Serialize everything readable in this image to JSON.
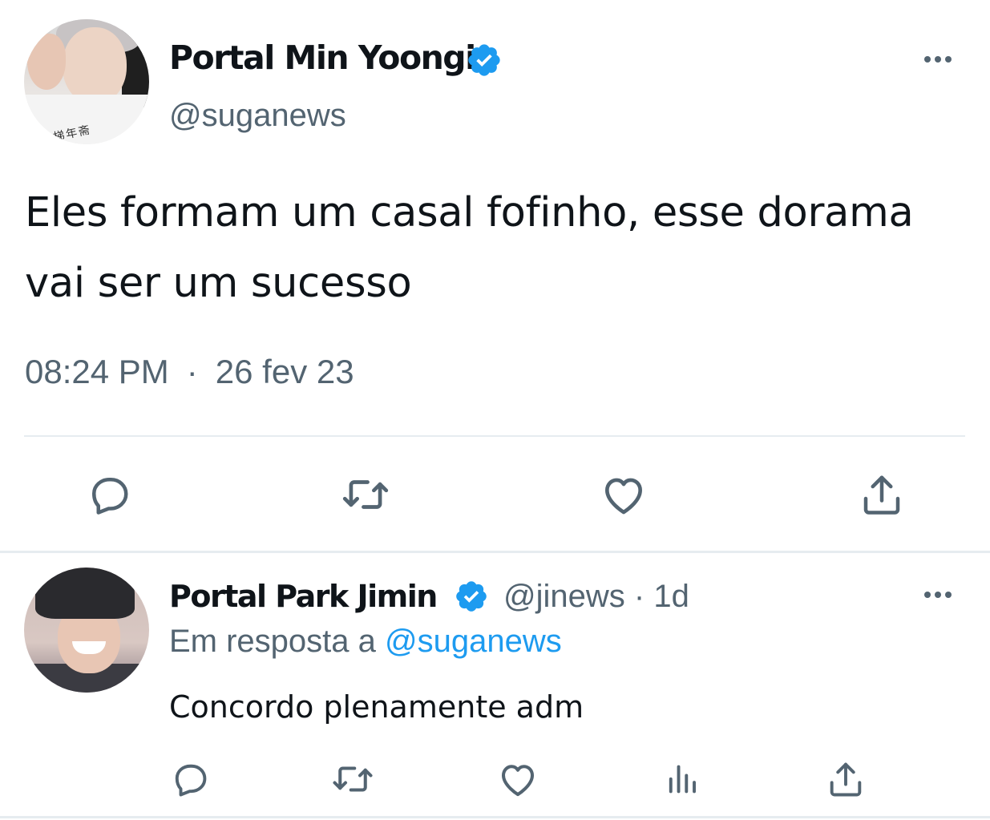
{
  "main_tweet": {
    "author_name": "Portal Min Yoongi",
    "author_handle": "@suganews",
    "avatar_shirt_text": "梯年斋",
    "text": "Eles formam um casal fofinho, esse dorama vai ser um sucesso",
    "time": "08:24 PM",
    "separator": "·",
    "date": "26 fev 23",
    "verified_color": "#1d9bf0",
    "actions": [
      "comment-icon",
      "retweet-icon",
      "like-icon",
      "share-icon"
    ]
  },
  "reply_tweet": {
    "author_name": "Portal Park Jimin",
    "author_handle": "@jinews",
    "separator": "·",
    "age": "1d",
    "reply_prefix": "Em resposta a",
    "reply_mention": "@suganews",
    "text": "Concordo plenamente adm",
    "actions": [
      "comment-icon",
      "retweet-icon",
      "like-icon",
      "analytics-icon",
      "share-icon"
    ]
  },
  "colors": {
    "text_primary": "#0f1419",
    "text_secondary": "#536471",
    "accent": "#1d9bf0",
    "divider": "#e6ecf0"
  }
}
